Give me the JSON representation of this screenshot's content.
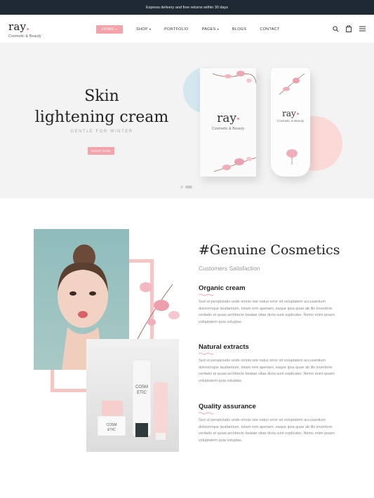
{
  "topbar": {
    "text": "Express delivery and free returns within 30 days"
  },
  "logo": {
    "word": "ray",
    "tagline": "Cosmetic & Beauty"
  },
  "menu": {
    "items": [
      {
        "label": "HOME",
        "caret": "▾",
        "active": true
      },
      {
        "label": "SHOP",
        "caret": "▾",
        "active": false
      },
      {
        "label": "PORTFOLIO",
        "caret": "",
        "active": false
      },
      {
        "label": "PAGES",
        "caret": "▾",
        "active": false
      },
      {
        "label": "BLOGS",
        "caret": "",
        "active": false
      },
      {
        "label": "CONTACT",
        "caret": "",
        "active": false
      }
    ]
  },
  "nav_icons": [
    "search-icon",
    "cart-icon",
    "menu-icon"
  ],
  "hero": {
    "title_line1": "Skin",
    "title_line2": "lightening cream",
    "subtitle": "GENTLE FOR WINTER",
    "button": "SHOP NOW",
    "box_word": "ray",
    "box_tagline": "Cosmetic & Beauty",
    "tube_word": "ray",
    "tube_tagline": "Cosmetic & Beauty"
  },
  "about": {
    "title": "#Genuine Cosmetics",
    "subtitle": "Customers Satisfaction",
    "features": [
      {
        "title": "Organic cream",
        "text": "Sed ut perspiciatis unde omnis iste natus error sit voluptatem accusantium doloremque laudantium, totam rem aperiam, eaque ipsa quae ab illo inventore veritatis et quasi architecto beatae vitae dicta sunt explicabo. Nemo enim ipsam voluptatem quia voluptas."
      },
      {
        "title": "Natural extracts",
        "text": "Sed ut perspiciatis unde omnis iste natus error sit voluptatem accusantium doloremque laudantium, totam rem aperiam, eaque ipsa quae ab illo inventore veritatis et quasi architecto beatae vitae dicta sunt explicabo. Nemo enim ipsam voluptatem quia voluptas."
      },
      {
        "title": "Quality assurance",
        "text": "Sed ut perspiciatis unde omnis iste natus error sit voluptatem accusantium doloremque laudantium, totam rem aperiam, eaque ipsa quae ab illo inventore veritatis et quasi architecto beatae vitae dicta sunt explicabo. Nemo enim ipsam voluptatem quia voluptas."
      }
    ],
    "product_label": "COSM ETIC"
  },
  "colors": {
    "accent": "#f5a3ab",
    "dark": "#1f2933",
    "hero_bg": "#f3f3f3",
    "blue": "#d3e7ef",
    "pink": "#fad9d6"
  }
}
